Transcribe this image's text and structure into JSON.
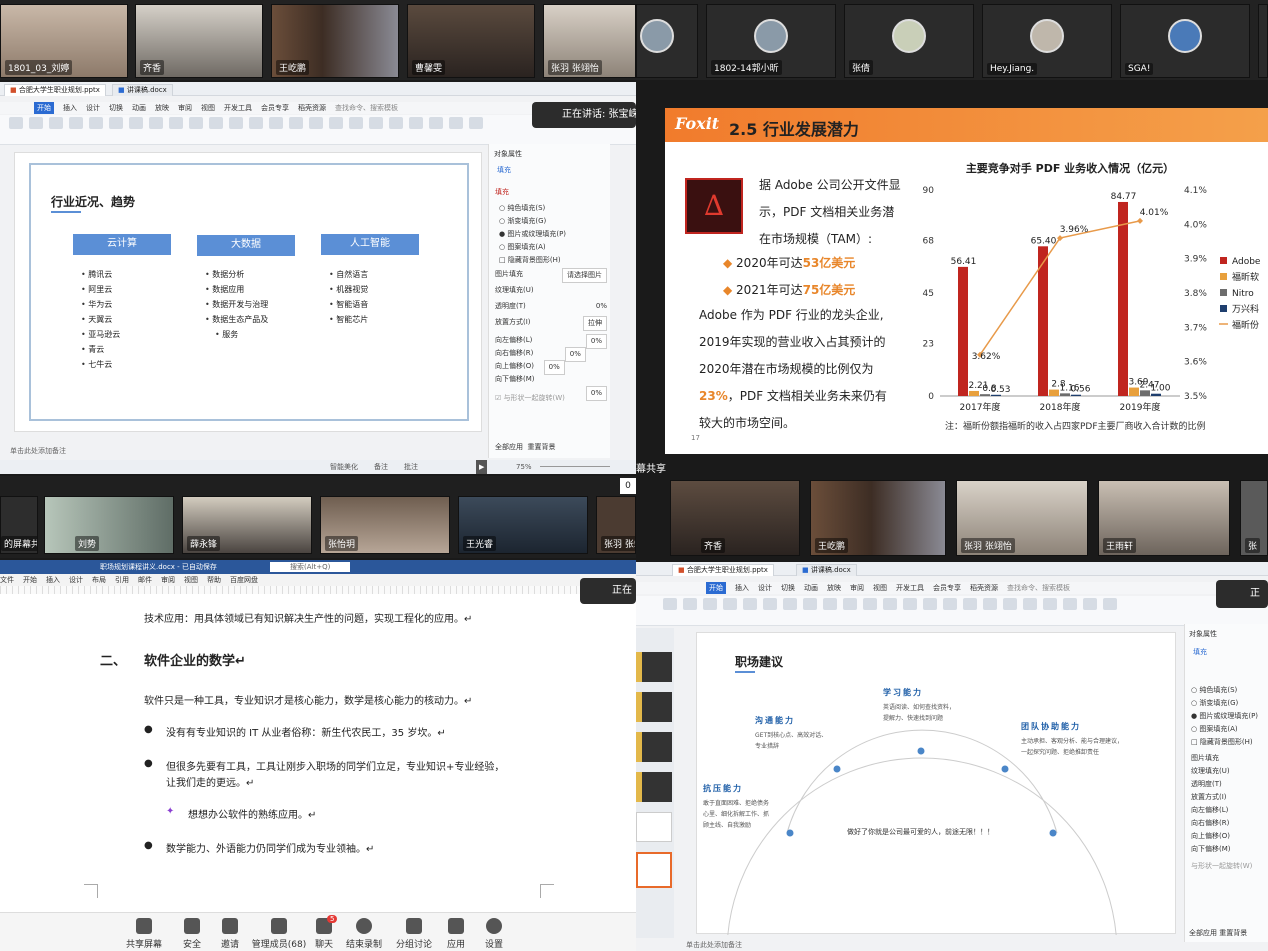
{
  "top_left_tiles": [
    "1801_03_刘婷",
    "齐香",
    "王屹鹏",
    "曹馨雯",
    "张羽 张翊怡"
  ],
  "top_right_tiles": [
    "",
    "1802-14郭小昕",
    "张倩",
    "Hey.Jiang.",
    "SGA!"
  ],
  "mid_left_tiles": [
    "的屏幕共享",
    "刘势",
    "薛永锋",
    "张怡玥",
    "王光睿",
    "张羽 张翊"
  ],
  "mid_right_tiles": [
    "齐香",
    "王屹鹏",
    "张羽 张翊怡",
    "",
    "王雨轩",
    "张"
  ],
  "mid_right_label": "幕共享",
  "q1": {
    "tabs": [
      "合肥大学生职业规划.pptx",
      "讲课稿.docx"
    ],
    "menu": [
      "开始",
      "插入",
      "设计",
      "切换",
      "动画",
      "放映",
      "审阅",
      "视图",
      "开发工具",
      "会员专享",
      "稻壳资源",
      "查找命令、搜索模板"
    ],
    "speaking": "正在讲话: 张宝嵘;",
    "slide_title": "行业近况、趋势",
    "columns": [
      {
        "head": "云计算",
        "items": [
          "腾讯云",
          "阿里云",
          "华为云",
          "天翼云",
          "亚马逊云",
          "青云",
          "七牛云"
        ]
      },
      {
        "head": "大数据",
        "items": [
          "数据分析",
          "数据应用",
          "数据开发与治理",
          "数据生态产品及",
          "服务"
        ]
      },
      {
        "head": "人工智能",
        "items": [
          "自然语言",
          "机器视觉",
          "智能语音",
          "智能芯片"
        ]
      }
    ],
    "panel_title": "对象属性",
    "panel_tab": "填充",
    "panel_section": "填充",
    "fill_options": [
      "纯色填充(S)",
      "渐变填充(G)",
      "图片或纹理填充(P)",
      "图案填充(A)",
      "隐藏背景图形(H)"
    ],
    "panel_rows": [
      {
        "label": "图片填充",
        "value": "请选择图片"
      },
      {
        "label": "纹理填充(U)",
        "value": ""
      },
      {
        "label": "透明度(T)",
        "value": "0%"
      },
      {
        "label": "放置方式(I)",
        "value": "拉伸"
      },
      {
        "label": "向左偏移(L)",
        "value": "0%"
      },
      {
        "label": "向右偏移(R)",
        "value": "0%"
      },
      {
        "label": "向上偏移(O)",
        "value": "0%"
      },
      {
        "label": "向下偏移(M)",
        "value": "0%"
      }
    ],
    "panel_check": "与形状一起旋转(W)",
    "panel_buttons": [
      "全部应用",
      "重置背景"
    ],
    "notes": "单击此处添加备注",
    "status": [
      "智能美化",
      "备注",
      "批注"
    ],
    "zoom": "75%"
  },
  "q2": {
    "logo": "Foxit",
    "title": "2.5 行业发展潜力",
    "lines": [
      "据 Adobe 公司公开文件显",
      "示，PDF 文档相关业务潜",
      "在市场规模（TAM）:"
    ],
    "bullets": [
      {
        "pre": "2020年可达",
        "hl": "53亿美元"
      },
      {
        "pre": "2021年可达",
        "hl": "75亿美元"
      }
    ],
    "para": [
      "Adobe 作为 PDF 行业的龙头企业,",
      "2019年实现的营业收入占其预计的",
      "2020年潜在市场规模的比例仅为"
    ],
    "para_last_hl": "23%",
    "para_last": "，PDF 文档相关业务未来仍有",
    "para_end": "较大的市场空间。",
    "page_no": "17",
    "note": "注：福昕份额指福昕的收入占四家PDF主要厂商收入合计数的比例"
  },
  "chart_data": {
    "type": "bar",
    "title": "主要竞争对手 PDF 业务收入情况（亿元）",
    "categories": [
      "2017年度",
      "2018年度",
      "2019年度"
    ],
    "series": [
      {
        "name": "Adobe",
        "values": [
          56.41,
          65.4,
          84.77
        ],
        "color": "#c0251f"
      },
      {
        "name": "福昕软",
        "values": [
          2.21,
          2.8,
          3.69
        ],
        "color": "#e8a03c"
      },
      {
        "name": "Nitro",
        "values": [
          0.8,
          1.16,
          2.47
        ],
        "color": "#6d6d6d"
      },
      {
        "name": "万兴科",
        "values": [
          0.53,
          0.56,
          1.0
        ],
        "color": "#1f3f6e"
      }
    ],
    "line_series": {
      "name": "福昕份",
      "values": [
        3.62,
        3.96,
        4.01
      ],
      "color": "#e89a4a"
    },
    "bar_labels": [
      [
        "56.41",
        "2.21",
        "0.8",
        "0.53"
      ],
      [
        "65.40",
        "2.8",
        "1.16",
        "0.56"
      ],
      [
        "84.77",
        "3.69",
        "2.47",
        "1.00"
      ]
    ],
    "line_labels": [
      "3.62%",
      "3.96%",
      "4.01%"
    ],
    "ylim": [
      0,
      90
    ],
    "yticks": [
      "0",
      "23",
      "45",
      "68",
      "90"
    ],
    "y2lim": [
      3.5,
      4.1
    ],
    "y2ticks": [
      "3.5%",
      "3.6%",
      "3.7%",
      "3.8%",
      "3.9%",
      "4.0%",
      "4.1%"
    ],
    "legend": "right"
  },
  "q3": {
    "title_bar": "职场规划课程讲义.docx - 已自动保存",
    "search": "搜索(Alt+Q)",
    "menu": [
      "文件",
      "开始",
      "插入",
      "设计",
      "布局",
      "引用",
      "邮件",
      "审阅",
      "视图",
      "帮助",
      "百度网盘"
    ],
    "speaking": "正在",
    "line1": "技术应用：用具体领域已有知识解决生产性的问题，实现工程化的应用。↵",
    "heading_num": "二、",
    "heading": "软件企业的数学↵",
    "para": "软件只是一种工具，专业知识才是核心能力，数学是核心能力的核动力。↵",
    "b1": "没有有专业知识的 IT 从业者俗称：新生代农民工，35 岁坎。↵",
    "b2a": "但很多先要有工具，工具让刚步入职场的同学们立足，专业知识+专业经验，",
    "b2b": "让我们走的更远。↵",
    "sub": "想想办公软件的熟练应用。↵",
    "b3": "数学能力、外语能力仍同学们成为专业领袖。↵",
    "toolbar": [
      {
        "label": "共享屏幕",
        "icon": "share-screen-icon"
      },
      {
        "label": "安全",
        "icon": "shield-icon"
      },
      {
        "label": "邀请",
        "icon": "invite-icon"
      },
      {
        "label": "管理成员(68)",
        "icon": "members-icon"
      },
      {
        "label": "聊天",
        "icon": "chat-icon",
        "badge": "5"
      },
      {
        "label": "结束录制",
        "icon": "record-stop-icon"
      },
      {
        "label": "分组讨论",
        "icon": "breakout-icon"
      },
      {
        "label": "应用",
        "icon": "apps-icon"
      },
      {
        "label": "设置",
        "icon": "gear-icon"
      }
    ]
  },
  "q4": {
    "tabs": [
      "合肥大学生职业规划.pptx",
      "讲课稿.docx"
    ],
    "menu": [
      "开始",
      "插入",
      "设计",
      "切换",
      "动画",
      "放映",
      "审阅",
      "视图",
      "开发工具",
      "会员专享",
      "稻壳资源",
      "查找命令、搜索模板"
    ],
    "speaking": "正",
    "slide_title": "职场建议",
    "nodes": [
      {
        "title": "学习能力",
        "lines": [
          "英语阅读、如何查找资料，",
          "提解力、快速找到问题"
        ]
      },
      {
        "title": "沟通能力",
        "lines": [
          "GET到核心点、高效对话、",
          "专业措辞"
        ]
      },
      {
        "title": "团队协助能力",
        "lines": [
          "主动承担、客观分析、能与合理建议，",
          "一起探究问题、拒绝推卸责任"
        ]
      },
      {
        "title": "抗压能力",
        "lines": [
          "敢于直面困难、拒绝债务",
          "心里、细化拆解工作、抓",
          "顾主线、自我激励"
        ]
      }
    ],
    "center_text": "做好了你就是公司最可爱的人，前途无限！！！",
    "panel_title": "对象属性",
    "panel_tab": "填充",
    "fill_options": [
      "纯色填充(S)",
      "渐变填充(G)",
      "图片或纹理填充(P)",
      "图案填充(A)",
      "隐藏背景图形(H)"
    ],
    "panel_rows": [
      "图片填充",
      "纹理填充(U)",
      "透明度(T)",
      "放置方式(I)",
      "向左偏移(L)",
      "向右偏移(R)",
      "向上偏移(O)",
      "向下偏移(M)"
    ],
    "panel_check": "与形状一起旋转(W)",
    "notes": "单击此处添加备注",
    "panel_buttons": [
      "全部应用",
      "重置背景"
    ]
  }
}
